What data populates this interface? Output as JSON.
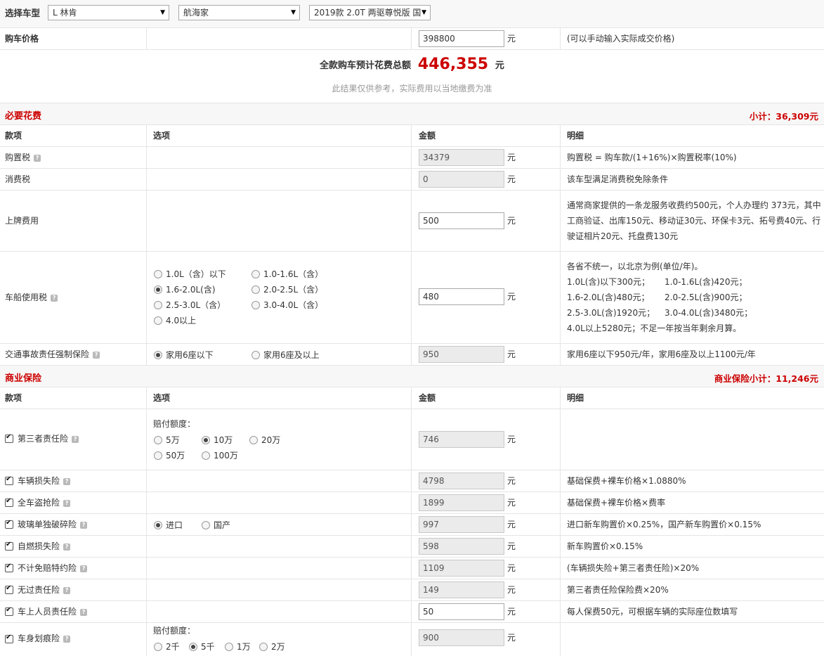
{
  "header": {
    "label": "选择车型",
    "brand": "L 林肯",
    "series": "航海家",
    "model": "2019款 2.0T 两驱尊悦版 国"
  },
  "price": {
    "label": "购车价格",
    "value": "398800",
    "unit": "元",
    "note": "(可以手动输入实际成交价格)"
  },
  "total": {
    "label": "全款购车预计花费总额",
    "value": "446,355",
    "unit": "元",
    "disclaimer": "此结果仅供参考，实际费用以当地缴费为准"
  },
  "columns": {
    "item": "款项",
    "option": "选项",
    "amount": "金额",
    "detail": "明细"
  },
  "required": {
    "title": "必要花费",
    "subtotal": "小计：36,309元",
    "rows": {
      "purchase_tax": {
        "name": "购置税",
        "amount": "34379",
        "detail": "购置税 = 购车款/(1+16%)×购置税率(10%)"
      },
      "consumption_tax": {
        "name": "消费税",
        "amount": "0",
        "detail": "该车型满足消费税免除条件"
      },
      "plate_fee": {
        "name": "上牌费用",
        "amount": "500",
        "detail_lines": [
          "通常商家提供的一条龙服务收费约500元，个人办理约 373元，其中",
          "工商验证、出库150元、移动证30元、环保卡3元、拓号费40元、行",
          "驶证相片20元、托盘费130元"
        ]
      },
      "vessel_tax": {
        "name": "车船使用税",
        "amount": "480",
        "options": [
          "1.0L（含）以下",
          "1.0-1.6L（含）",
          "1.6-2.0L(含)",
          "2.0-2.5L（含）",
          "2.5-3.0L（含）",
          "3.0-4.0L（含）",
          "4.0以上"
        ],
        "selected": "1.6-2.0L(含)",
        "detail_lines": [
          "各省不统一，以北京为例(单位/年)。",
          "1.0L(含)以下300元；",
          "1.0-1.6L(含)420元；",
          "1.6-2.0L(含)480元；",
          "2.0-2.5L(含)900元；",
          "2.5-3.0L(含)1920元；",
          "3.0-4.0L(含)3480元；",
          "4.0L以上5280元；不足一年按当年剩余月算。"
        ]
      },
      "compulsory_insurance": {
        "name": "交通事故责任强制保险",
        "amount": "950",
        "options": [
          "家用6座以下",
          "家用6座及以上"
        ],
        "selected": "家用6座以下",
        "detail": "家用6座以下950元/年，家用6座及以上1100元/年"
      }
    }
  },
  "commercial": {
    "title": "商业保险",
    "subtotal": "商业保险小计：11,246元",
    "rows": {
      "third_party": {
        "name": "第三者责任险",
        "amount": "746",
        "coverage_label": "赔付额度：",
        "options": [
          "5万",
          "10万",
          "20万",
          "50万",
          "100万"
        ],
        "selected": "10万",
        "detail": ""
      },
      "vehicle_damage": {
        "name": "车辆损失险",
        "amount": "4798",
        "detail": "基础保费+裸车价格×1.0880%"
      },
      "theft": {
        "name": "全车盗抢险",
        "amount": "1899",
        "detail": "基础保费+裸车价格×费率"
      },
      "glass": {
        "name": "玻璃单独破碎险",
        "amount": "997",
        "options": [
          "进口",
          "国产"
        ],
        "selected": "进口",
        "detail": "进口新车购置价×0.25%，国产新车购置价×0.15%"
      },
      "self_ignition": {
        "name": "自燃损失险",
        "amount": "598",
        "detail": "新车购置价×0.15%"
      },
      "deductible": {
        "name": "不计免赔特约险",
        "amount": "1109",
        "detail": "(车辆损失险+第三者责任险)×20%"
      },
      "no_fault": {
        "name": "无过责任险",
        "amount": "149",
        "detail": "第三者责任险保险费×20%"
      },
      "passenger": {
        "name": "车上人员责任险",
        "amount": "50",
        "detail": "每人保费50元，可根据车辆的实际座位数填写"
      },
      "scratch": {
        "name": "车身划痕险",
        "amount": "900",
        "coverage_label": "赔付额度：",
        "options": [
          "2千",
          "5千",
          "1万",
          "2万"
        ],
        "selected": "5千",
        "detail": ""
      }
    }
  },
  "help_icon": "question-help-icon",
  "colors": {
    "accent_red": "#cc0000",
    "border": "#e5e5e5",
    "readonly_bg": "#ebebeb"
  }
}
